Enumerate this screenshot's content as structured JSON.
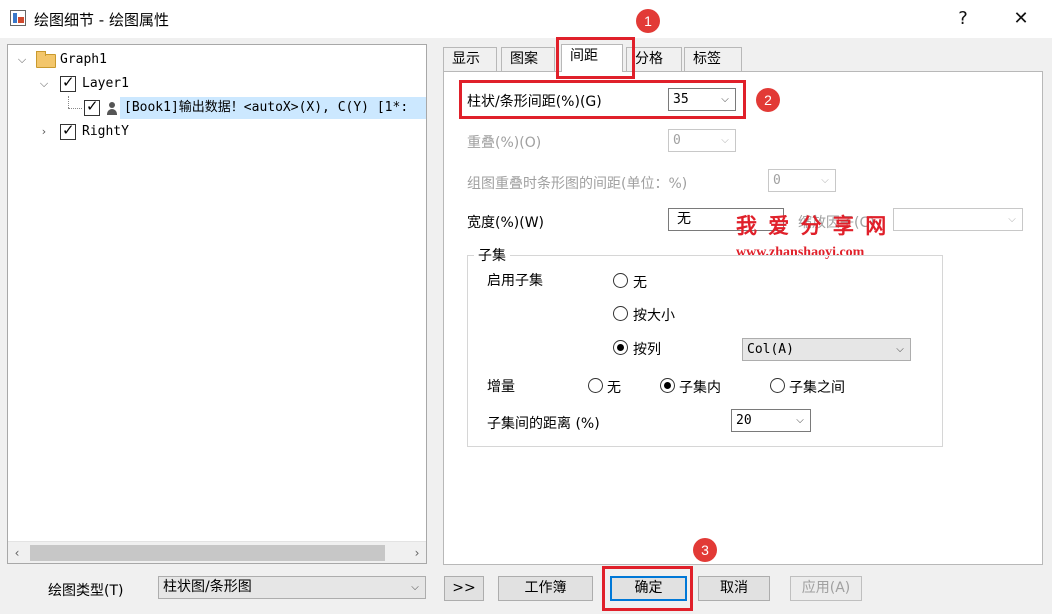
{
  "window": {
    "title": "绘图细节 - 绘图属性",
    "help_label": "?",
    "close_label": "✕"
  },
  "tree": {
    "graph": "Graph1",
    "layer": "Layer1",
    "plot": "[Book1]输出数据！<autoX>(X), C(Y) [1*:",
    "axis": "RightY",
    "scroll_left": "‹",
    "scroll_right": "›"
  },
  "tabs": [
    "显示",
    "图案",
    "间距",
    "分格",
    "标签"
  ],
  "spacing": {
    "gap_label": "柱状/条形间距(%)(G)",
    "gap_value": "35",
    "overlap_label": "重叠(%)(O)",
    "overlap_value": "0",
    "group_overlap_label": "组图重叠时条形图的间距(单位：%)",
    "group_overlap_value": "0",
    "width_label": "宽度(%)(W)",
    "width_value": "无",
    "scale_label": "缩放因子(C)"
  },
  "subset": {
    "group_title": "子集",
    "enable_label": "启用子集",
    "option_none": "无",
    "option_by_size": "按大小",
    "option_by_column": "按列",
    "column_value": "Col(A)",
    "increment_label": "增量",
    "inc_none": "无",
    "inc_within": "子集内",
    "inc_between": "子集之间",
    "distance_label": "子集间的距离 (%)",
    "distance_value": "20"
  },
  "bottom": {
    "plot_type_label": "绘图类型(T)",
    "plot_type_value": "柱状图/条形图",
    "expand_label": ">>",
    "workbook_label": "工作簿",
    "ok_label": "确定",
    "cancel_label": "取消",
    "apply_label": "应用(A)"
  },
  "annotations": {
    "badge1": "1",
    "badge2": "2",
    "badge3": "3",
    "watermark_title": "我 爱 分 享 网",
    "watermark_url": "www.zhanshaoyi.com",
    "highlight_color": "#e0202a"
  }
}
